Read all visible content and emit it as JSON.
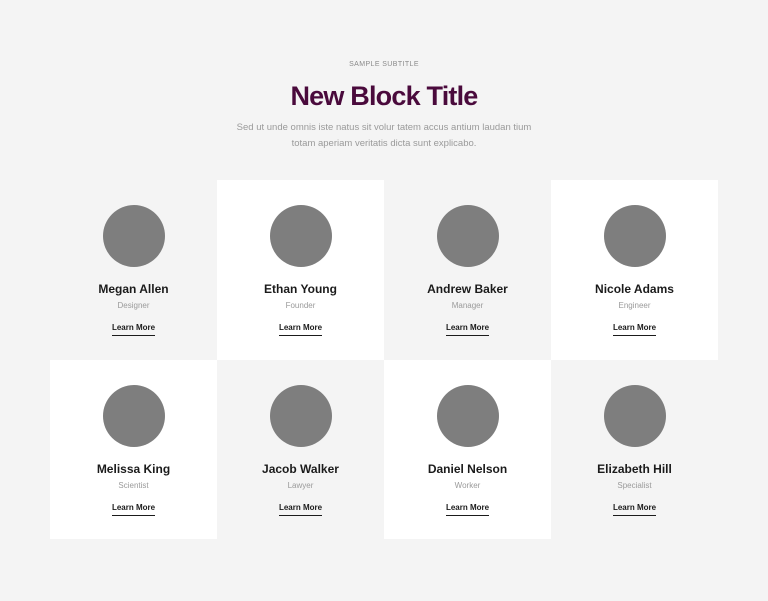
{
  "header": {
    "subtitle": "SAMPLE SUBTITLE",
    "title": "New Block Title",
    "description": "Sed ut unde omnis iste natus sit volur tatem accus antium laudan tium totam aperiam veritatis dicta sunt explicabo."
  },
  "colors": {
    "accent": "#4a0a3c",
    "avatar": "#7e7e7e",
    "background": "#f4f4f4",
    "card": "#ffffff"
  },
  "team": [
    {
      "name": "Megan Allen",
      "role": "Designer",
      "link": "Learn More"
    },
    {
      "name": "Ethan Young",
      "role": "Founder",
      "link": "Learn More"
    },
    {
      "name": "Andrew Baker",
      "role": "Manager",
      "link": "Learn More"
    },
    {
      "name": "Nicole Adams",
      "role": "Engineer",
      "link": "Learn More"
    },
    {
      "name": "Melissa King",
      "role": "Scientist",
      "link": "Learn More"
    },
    {
      "name": "Jacob Walker",
      "role": "Lawyer",
      "link": "Learn More"
    },
    {
      "name": "Daniel Nelson",
      "role": "Worker",
      "link": "Learn More"
    },
    {
      "name": "Elizabeth Hill",
      "role": "Specialist",
      "link": "Learn More"
    }
  ]
}
